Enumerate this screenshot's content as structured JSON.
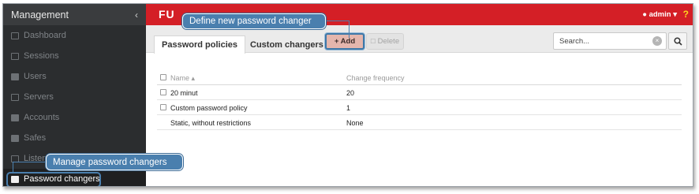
{
  "sidebar": {
    "title": "Management",
    "collapse_glyph": "‹",
    "items": [
      {
        "label": "Dashboard",
        "icon": "dashboard-icon"
      },
      {
        "label": "Sessions",
        "icon": "film-icon"
      },
      {
        "label": "Users",
        "icon": "users-icon"
      },
      {
        "label": "Servers",
        "icon": "server-icon"
      },
      {
        "label": "Accounts",
        "icon": "book-icon"
      },
      {
        "label": "Safes",
        "icon": "safe-icon"
      },
      {
        "label": "Listeners",
        "icon": "rss-icon"
      },
      {
        "label": "Password changers",
        "icon": "plug-icon",
        "active": true
      }
    ]
  },
  "topbar": {
    "brand": "FU",
    "user": "admin",
    "user_glyph": "▾",
    "help": "?"
  },
  "tabs": [
    {
      "label": "Password policies",
      "active": true
    },
    {
      "label": "Custom changers",
      "active": false
    }
  ],
  "toolbar": {
    "add_label": "+ Add",
    "delete_label": "Delete"
  },
  "search": {
    "placeholder": "Search...",
    "clear_glyph": "×"
  },
  "table": {
    "columns": [
      "Name ▴",
      "Change frequency"
    ],
    "rows": [
      {
        "name": "20 minut",
        "frequency": "20",
        "checkbox": true
      },
      {
        "name": "Custom password policy",
        "frequency": "1",
        "checkbox": true
      },
      {
        "name": "Static, without restrictions",
        "frequency": "None",
        "checkbox": false
      }
    ]
  },
  "callouts": {
    "define": "Define new password changer",
    "manage": "Manage password changers"
  },
  "colors": {
    "topbar": "#d41f26",
    "sidebar": "#2b2d2f",
    "callout": "#4a7fae",
    "add_button": "#e4b6ad"
  }
}
